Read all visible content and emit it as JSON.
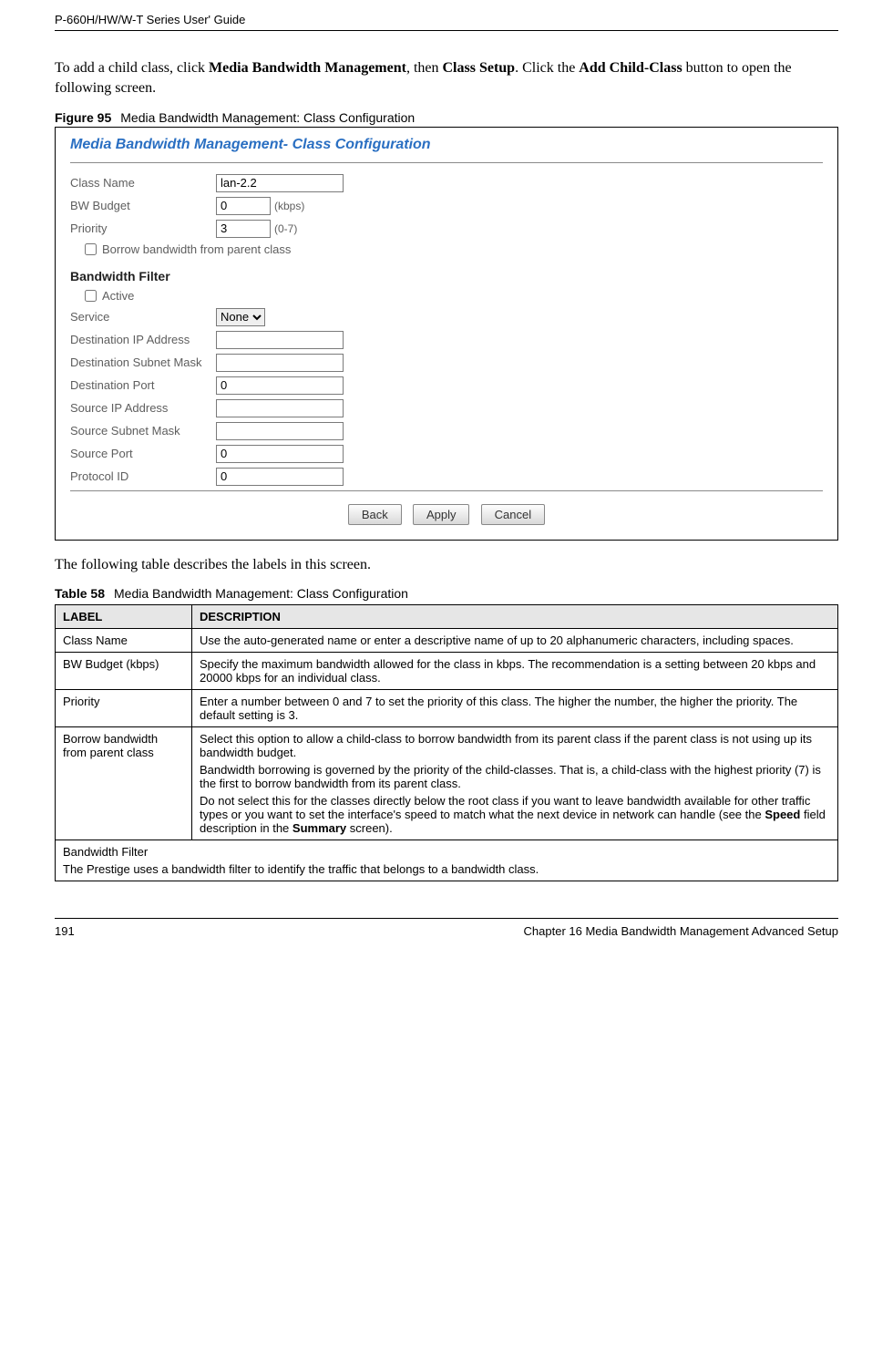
{
  "header": {
    "title": "P-660H/HW/W-T Series User' Guide"
  },
  "intro": {
    "line1_pre": "To add a child class, click ",
    "bold1": "Media Bandwidth Management",
    "mid1": ", then ",
    "bold2": "Class Setup",
    "mid2": ". Click the ",
    "bold3": "Add Child-Class",
    "tail": " button to open the following screen."
  },
  "figure": {
    "number": "Figure 95",
    "caption": "Media Bandwidth Management: Class Configuration"
  },
  "screenshot": {
    "title": "Media Bandwidth Management- Class Configuration",
    "labels": {
      "class_name": "Class Name",
      "bw_budget": "BW Budget",
      "priority": "Priority",
      "borrow": "Borrow bandwidth from parent class",
      "bandwidth_filter": "Bandwidth Filter",
      "active": "Active",
      "service": "Service",
      "dest_ip": "Destination IP Address",
      "dest_mask": "Destination Subnet Mask",
      "dest_port": "Destination Port",
      "src_ip": "Source IP Address",
      "src_mask": "Source Subnet Mask",
      "src_port": "Source Port",
      "protocol_id": "Protocol ID"
    },
    "values": {
      "class_name": "lan-2.2",
      "bw_budget": "0",
      "priority": "3",
      "service": "None",
      "dest_ip": "",
      "dest_mask": "",
      "dest_port": "0",
      "src_ip": "",
      "src_mask": "",
      "src_port": "0",
      "protocol_id": "0"
    },
    "suffix": {
      "kbps": "(kbps)",
      "zero_seven": "(0-7)"
    },
    "buttons": {
      "back": "Back",
      "apply": "Apply",
      "cancel": "Cancel"
    }
  },
  "after_fig_para": "The following table describes the labels in this screen.",
  "table": {
    "number": "Table 58",
    "caption": "Media Bandwidth Management: Class Configuration",
    "headers": {
      "label": "LABEL",
      "description": "DESCRIPTION"
    },
    "rows": [
      {
        "label": "Class Name",
        "desc": [
          "Use the auto-generated name or enter a descriptive name of up to 20 alphanumeric characters, including spaces."
        ]
      },
      {
        "label": "BW Budget (kbps)",
        "desc": [
          "Specify the maximum bandwidth allowed for the class in kbps. The recommendation is a setting between 20 kbps and 20000 kbps for an individual class."
        ]
      },
      {
        "label": "Priority",
        "desc": [
          "Enter a number between 0 and 7 to set the priority of this class. The higher the number, the higher the priority. The default setting is 3."
        ]
      },
      {
        "label": "Borrow bandwidth from parent class",
        "desc_parts": {
          "p1": "Select this option to allow a child-class to borrow bandwidth from its parent class if the parent class is not using up its bandwidth budget.",
          "p2": "Bandwidth borrowing is governed by the priority of the child-classes. That is, a child-class with the highest priority (7) is the first to borrow bandwidth from its parent class.",
          "p3_pre": "Do not select this for the classes directly below the root class if you want to leave bandwidth available for other traffic types or you want to set the interface's speed to match what the next device in network can handle (see the ",
          "p3_bold1": "Speed",
          "p3_mid": " field description in the ",
          "p3_bold2": "Summary",
          "p3_tail": " screen)."
        }
      },
      {
        "label_full": "Bandwidth Filter",
        "full_row": "The Prestige uses a bandwidth filter to identify the traffic that belongs to a bandwidth class."
      }
    ]
  },
  "footer": {
    "page": "191",
    "chapter": "Chapter 16 Media Bandwidth Management Advanced Setup"
  }
}
